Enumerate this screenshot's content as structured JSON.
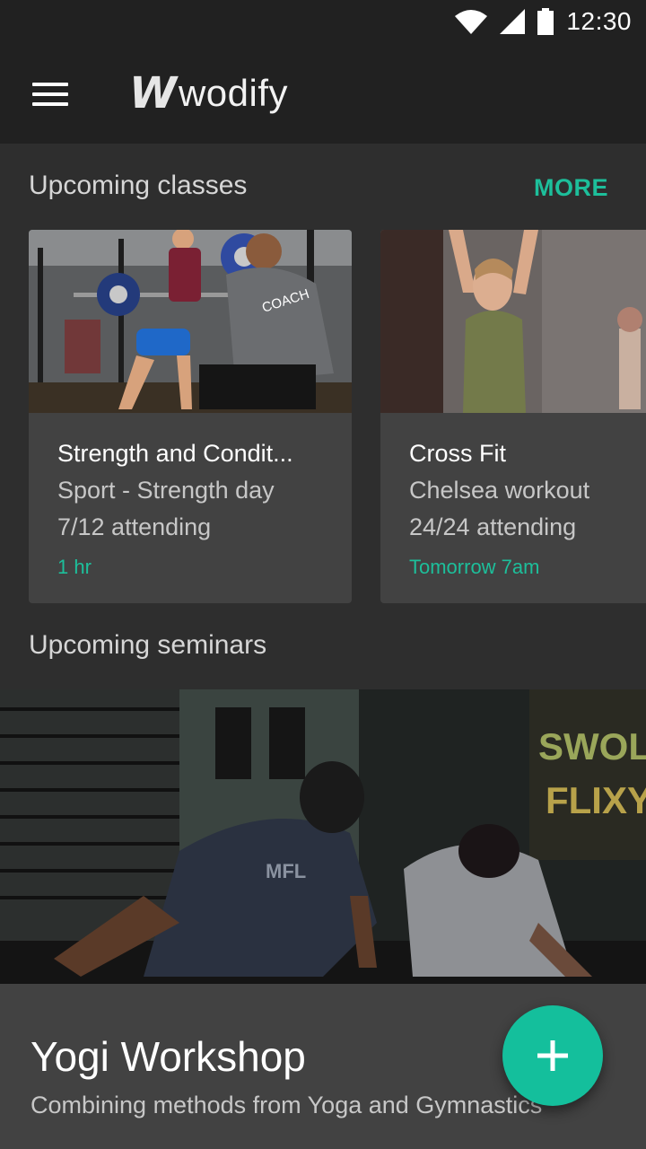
{
  "status_bar": {
    "time": "12:30",
    "icons": [
      "wifi-icon",
      "signal-icon",
      "battery-icon"
    ]
  },
  "app_bar": {
    "menu_icon": "hamburger-menu-icon",
    "logo_mark": "W",
    "logo_text": "wodify"
  },
  "colors": {
    "accent": "#1dbf9b",
    "background": "#2e2e2e",
    "card": "#424242",
    "bar": "#212121"
  },
  "upcoming_classes": {
    "title": "Upcoming classes",
    "more_label": "MORE",
    "cards": [
      {
        "name": "Strength and Condit...",
        "subtitle": "Sport - Strength day",
        "attending": "7/12 attending",
        "when": "1 hr",
        "photo_text": "COACH"
      },
      {
        "name": "Cross Fit",
        "subtitle": "Chelsea workout",
        "attending": "24/24 attending",
        "when": "Tomorrow 7am"
      }
    ]
  },
  "upcoming_seminars": {
    "title": "Upcoming seminars",
    "card": {
      "title": "Yogi Workshop",
      "subtitle": "Combining methods from Yoga and Gymnastics",
      "photo_sign_lines": [
        "SWOLE",
        "FLIXY"
      ],
      "photo_shirt_text": "MFL"
    }
  },
  "fab": {
    "icon": "plus-icon"
  }
}
